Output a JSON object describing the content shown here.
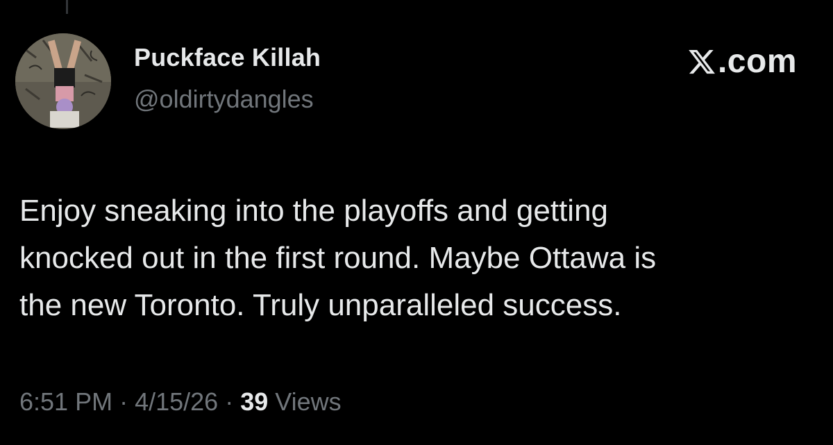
{
  "colors": {
    "background": "#000000",
    "primary_text": "#e7e9ea",
    "secondary_text": "#71767b",
    "thread_line": "#333639"
  },
  "author": {
    "display_name": "Puckface Killah",
    "handle": "@oldirtydangles",
    "avatar_icon": "profile-photo"
  },
  "brand": {
    "logo_icon": "x-logo-icon",
    "suffix": ".com"
  },
  "tweet": {
    "lines": [
      "Enjoy sneaking into the playoffs and getting",
      "knocked out in the first round. Maybe Ottawa is",
      "the new Toronto. Truly unparalleled success."
    ]
  },
  "meta": {
    "time": "6:51 PM",
    "separator": " · ",
    "date": "4/15/26",
    "view_count": "39",
    "views_label": " Views"
  }
}
